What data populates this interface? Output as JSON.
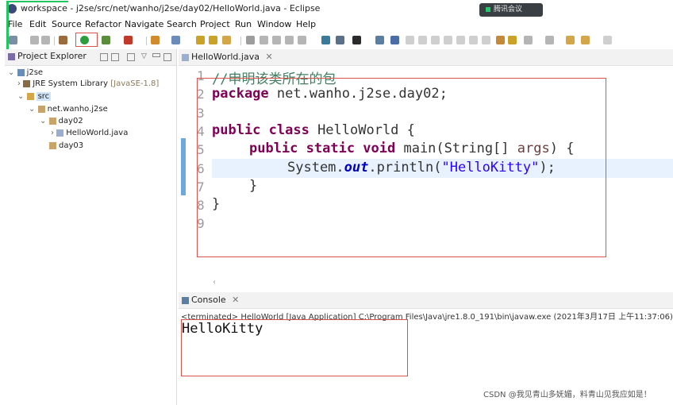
{
  "window": {
    "title": "workspace - j2se/src/net/wanho/j2se/day02/HelloWorld.java - Eclipse"
  },
  "meeting": {
    "label": "腾讯会议"
  },
  "menu": [
    "File",
    "Edit",
    "Source",
    "Refactor",
    "Navigate",
    "Search",
    "Project",
    "Run",
    "Window",
    "Help"
  ],
  "explorer": {
    "tab_label": "Project Explorer",
    "items": [
      {
        "label": "j2se",
        "icon": "project-icon"
      },
      {
        "label": "JRE System Library",
        "suffix": "[JavaSE-1.8]",
        "icon": "library-icon"
      },
      {
        "label": "src",
        "icon": "source-folder-icon"
      },
      {
        "label": "net.wanho.j2se",
        "icon": "package-icon"
      },
      {
        "label": "day02",
        "icon": "package-icon"
      },
      {
        "label": "HelloWorld.java",
        "icon": "java-file-icon"
      },
      {
        "label": "day03",
        "icon": "package-icon"
      }
    ]
  },
  "editor": {
    "tab_label": "HelloWorld.java",
    "line_numbers": [
      "1",
      "2",
      "3",
      "4",
      "5",
      "6",
      "7",
      "8",
      "9"
    ],
    "lines": {
      "l1": "//申明该类所在的包",
      "l2_kw": "package",
      "l2_rest": " net.wanho.j2se.day02;",
      "l4_kw": "public class",
      "l4_rest": " HelloWorld {",
      "l5_kw": "public static void",
      "l5_rest1": " main(String[] ",
      "l5_param": "args",
      "l5_rest2": ") {",
      "l6_pre": "System.",
      "l6_field": "out",
      "l6_mid": ".println(",
      "l6_str": "\"HelloKitty\"",
      "l6_end": ");",
      "l7": "}",
      "l8": "}"
    }
  },
  "console": {
    "tab_label": "Console",
    "status": "<terminated> HelloWorld [Java Application] C:\\Program Files\\Java\\jre1.8.0_191\\bin\\javaw.exe (2021年3月17日 上午11:37:06)",
    "output": "HelloKitty"
  },
  "watermark": "CSDN @我见青山多妩媚，料青山见我应如是！",
  "colors": {
    "keyword": "#7f0055",
    "string": "#2a00ff",
    "annotation_box": "#d9534f",
    "run_icon": "#2e9e3c"
  }
}
